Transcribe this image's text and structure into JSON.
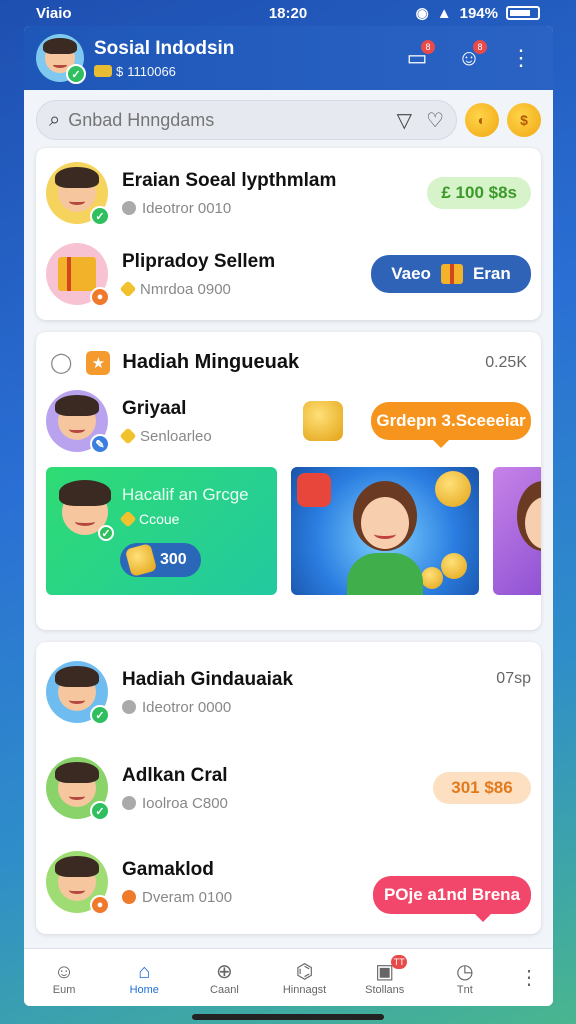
{
  "status_bar": {
    "left": "Viaio",
    "time": "18:20",
    "battery": "194%"
  },
  "app_bar": {
    "title": "Sosial Indodsin",
    "subtitle": "1110066",
    "icons": [
      "chat-bubble-icon",
      "people-icon",
      "more-vertical-icon"
    ],
    "badge_1": "8",
    "badge_2": "8"
  },
  "search": {
    "placeholder": "Gnbad Hnngdams"
  },
  "top_card": {
    "rows": [
      {
        "title": "Eraian Soeal lypthmlam",
        "sub": "Ideotror 0010",
        "action": "100 $8s",
        "action_prefix": "£"
      },
      {
        "title": "Plipradoy Sellem",
        "sub": "Nmrdoa 0900",
        "action_left": "Vaeo",
        "action_right": "Eran"
      }
    ]
  },
  "section": {
    "title": "Hadiah Mingueuak",
    "count": "0.25K",
    "row": {
      "title": "Griyaal",
      "sub": "Senloarleo",
      "action": "Grdepn 3.Sceeeiar"
    },
    "tiles": [
      {
        "title": "Hacalif an Grcge",
        "sub": "Ccoue",
        "coin": "300"
      }
    ]
  },
  "bottom_card": {
    "title": "Hadiah Gindauaiak",
    "count": "07sp",
    "rows": [
      {
        "title": "Hadiah Gindauaiak",
        "sub": "Ideotror 0000"
      },
      {
        "title": "Adlkan Cral",
        "sub": "Ioolroa C800",
        "action": "301 $86"
      },
      {
        "title": "Gamaklod",
        "sub": "Dveram 0100",
        "action": "POje a1nd Brena"
      }
    ]
  },
  "bottom_nav": {
    "items": [
      {
        "label": "Eum",
        "icon": "smile-icon"
      },
      {
        "label": "Home",
        "icon": "home-icon"
      },
      {
        "label": "Caanl",
        "icon": "plus-circle-icon"
      },
      {
        "label": "Hinnagst",
        "icon": "share-icon"
      },
      {
        "label": "Stollans",
        "icon": "store-icon",
        "badge": "TT"
      },
      {
        "label": "Tnt",
        "icon": "clock-icon"
      }
    ]
  },
  "colors": {
    "primary": "#2a63c4",
    "accent_orange": "#f7941d",
    "accent_pink": "#f2476b",
    "accent_green": "#3c9a2b"
  }
}
